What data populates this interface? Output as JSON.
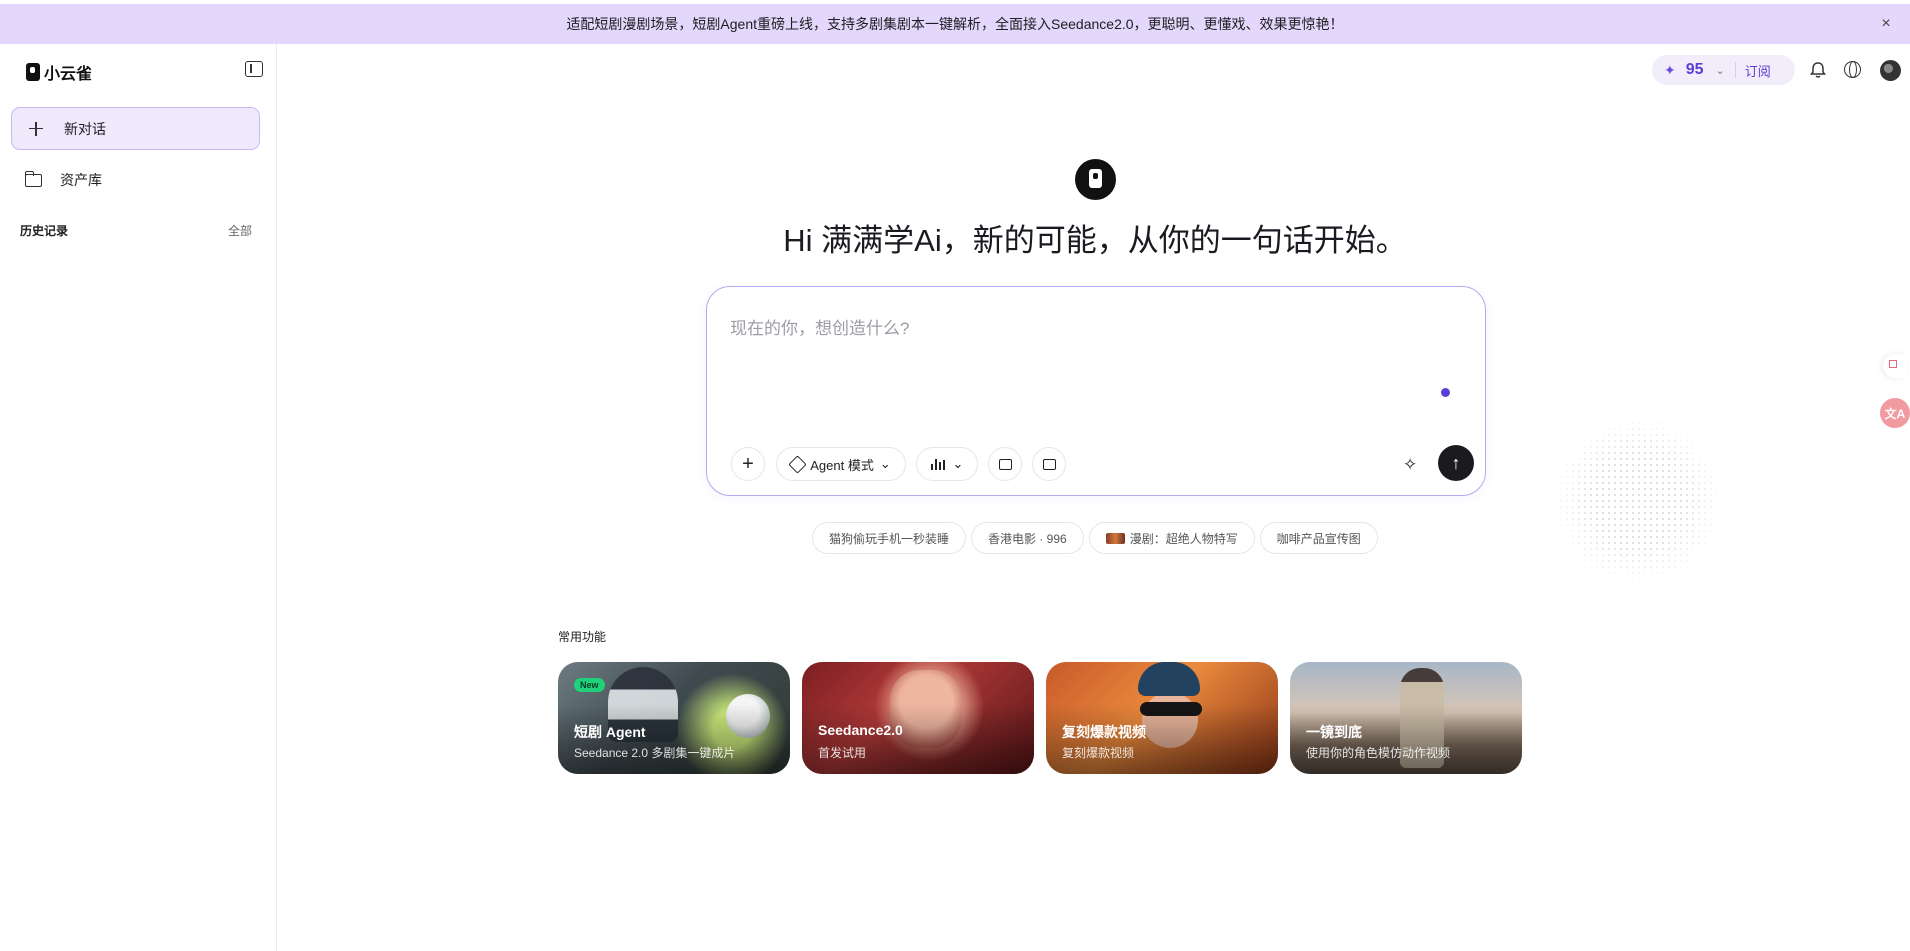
{
  "banner": {
    "text": "适配短剧漫剧场景，短剧Agent重磅上线，支持多剧集剧本一键解析，全面接入Seedance2.0，更聪明、更懂戏、效果更惊艳！",
    "close_icon": "×"
  },
  "sidebar": {
    "logo_text": "小云雀",
    "new_chat_label": "新对话",
    "assets_label": "资产库",
    "history_title": "历史记录",
    "history_all": "全部"
  },
  "topbar": {
    "credits_icon": "✦",
    "credits_count": "95",
    "credits_chevron": "⌄",
    "subscribe_label": "订阅",
    "bell_icon": "🔔︎"
  },
  "hero": {
    "title": "Hi 满满学Ai，新的可能，从你的一句话开始。"
  },
  "composer": {
    "placeholder": "现在的你，想创造什么?",
    "value": "",
    "plus_icon": "+",
    "agent_mode_label": "Agent 模式",
    "chevron": "⌄",
    "wand_icon": "✧",
    "send_icon": "↑"
  },
  "suggestions": [
    {
      "label": "猫狗偷玩手机一秒装睡",
      "has_thumb": false
    },
    {
      "label": "香港电影 · 996",
      "has_thumb": false
    },
    {
      "label": "漫剧：超绝人物特写",
      "has_thumb": true
    },
    {
      "label": "咖啡产品宣传图",
      "has_thumb": false
    }
  ],
  "right_float": {
    "translate_label": "文A"
  },
  "features": {
    "title": "常用功能",
    "cards": [
      {
        "title": "短剧 Agent",
        "subtitle": "Seedance 2.0 多剧集一键成片",
        "badge": "New"
      },
      {
        "title": "Seedance2.0",
        "subtitle": "首发试用"
      },
      {
        "title": "复刻爆款视频",
        "subtitle": "复刻爆款视频"
      },
      {
        "title": "一镜到底",
        "subtitle": "使用你的角色模仿动作视频"
      }
    ]
  },
  "colors": {
    "banner_bg": "#e3d8fb",
    "accent": "#5b3fd4",
    "new_chat_bg": "#efe9fb",
    "send_button": "#1b1b1f",
    "badge_new": "#1fd27a"
  }
}
